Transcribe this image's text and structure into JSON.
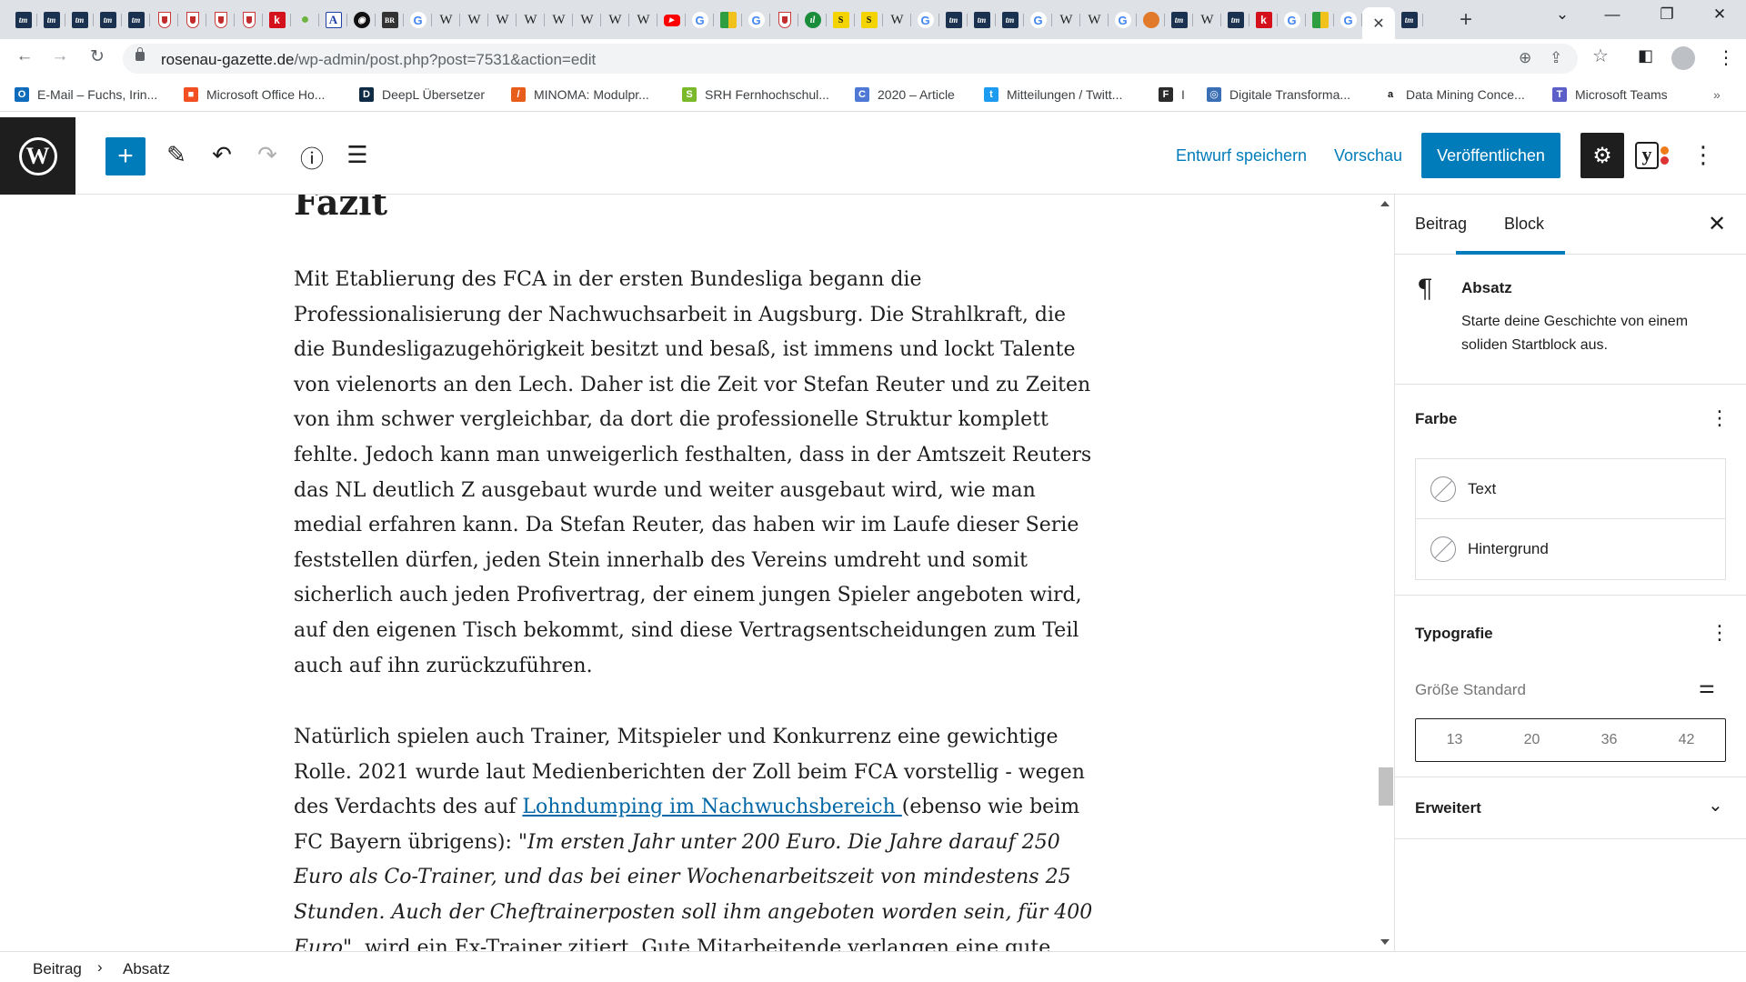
{
  "browser": {
    "tabs": [
      {
        "icon": "transfermarkt-icon",
        "glyph": "tm",
        "kind": "tm"
      },
      {
        "icon": "transfermarkt-icon",
        "glyph": "tm",
        "kind": "tm"
      },
      {
        "icon": "transfermarkt-icon",
        "glyph": "tm",
        "kind": "tm"
      },
      {
        "icon": "transfermarkt-icon",
        "glyph": "tm",
        "kind": "tm"
      },
      {
        "icon": "transfermarkt-icon",
        "glyph": "tm",
        "kind": "tm"
      },
      {
        "icon": "fc-augsburg-icon",
        "glyph": "",
        "kind": "fca"
      },
      {
        "icon": "fc-augsburg-icon",
        "glyph": "",
        "kind": "fca"
      },
      {
        "icon": "fc-augsburg-icon",
        "glyph": "",
        "kind": "fca"
      },
      {
        "icon": "fc-augsburg-icon",
        "glyph": "",
        "kind": "fca"
      },
      {
        "icon": "kicker-icon",
        "glyph": "k",
        "kind": "k"
      },
      {
        "icon": "maps-pin-icon",
        "glyph": "●",
        "kind": "pin"
      },
      {
        "icon": "a-icon",
        "glyph": "A",
        "kind": "a"
      },
      {
        "icon": "black-circle-icon",
        "glyph": "◉",
        "kind": "blk"
      },
      {
        "icon": "dark-icon",
        "glyph": "BR",
        "kind": "dark"
      },
      {
        "icon": "google-icon",
        "glyph": "G",
        "kind": "g"
      },
      {
        "icon": "wikipedia-icon",
        "glyph": "W",
        "kind": "w"
      },
      {
        "icon": "wikipedia-icon",
        "glyph": "W",
        "kind": "w"
      },
      {
        "icon": "wikipedia-icon",
        "glyph": "W",
        "kind": "w"
      },
      {
        "icon": "wikipedia-icon",
        "glyph": "W",
        "kind": "w"
      },
      {
        "icon": "wikipedia-icon",
        "glyph": "W",
        "kind": "w"
      },
      {
        "icon": "wikipedia-icon",
        "glyph": "W",
        "kind": "w"
      },
      {
        "icon": "wikipedia-icon",
        "glyph": "W",
        "kind": "w"
      },
      {
        "icon": "wikipedia-icon",
        "glyph": "W",
        "kind": "w"
      },
      {
        "icon": "youtube-icon",
        "glyph": "▶",
        "kind": "yt"
      },
      {
        "icon": "google-icon",
        "glyph": "G",
        "kind": "g"
      },
      {
        "icon": "grid-icon",
        "glyph": "",
        "kind": "grid"
      },
      {
        "icon": "google-icon",
        "glyph": "G",
        "kind": "g"
      },
      {
        "icon": "fc-augsburg-icon",
        "glyph": "",
        "kind": "fca"
      },
      {
        "icon": "green-circle-icon",
        "glyph": "ıl",
        "kind": "grn"
      },
      {
        "icon": "s-icon",
        "glyph": "S",
        "kind": "ys"
      },
      {
        "icon": "s-icon",
        "glyph": "S",
        "kind": "ys"
      },
      {
        "icon": "wikipedia-icon",
        "glyph": "W",
        "kind": "w"
      },
      {
        "icon": "google-icon",
        "glyph": "G",
        "kind": "g"
      },
      {
        "icon": "transfermarkt-icon",
        "glyph": "tm",
        "kind": "tm"
      },
      {
        "icon": "transfermarkt-icon",
        "glyph": "tm",
        "kind": "tm"
      },
      {
        "icon": "transfermarkt-icon",
        "glyph": "tm",
        "kind": "tm"
      },
      {
        "icon": "google-icon",
        "glyph": "G",
        "kind": "g"
      },
      {
        "icon": "wikipedia-icon",
        "glyph": "W",
        "kind": "w"
      },
      {
        "icon": "wikipedia-icon",
        "glyph": "W",
        "kind": "w"
      },
      {
        "icon": "google-icon",
        "glyph": "G",
        "kind": "g"
      },
      {
        "icon": "orange-circle-icon",
        "glyph": "",
        "kind": "orn"
      },
      {
        "icon": "transfermarkt-icon",
        "glyph": "tm",
        "kind": "tm"
      },
      {
        "icon": "wikipedia-icon",
        "glyph": "W",
        "kind": "w"
      },
      {
        "icon": "transfermarkt-icon",
        "glyph": "tm",
        "kind": "tm"
      },
      {
        "icon": "kicker-icon",
        "glyph": "k",
        "kind": "k"
      },
      {
        "icon": "google-icon",
        "glyph": "G",
        "kind": "g"
      },
      {
        "icon": "grid-icon",
        "glyph": "",
        "kind": "grid"
      },
      {
        "icon": "google-icon",
        "glyph": "G",
        "kind": "g"
      }
    ],
    "active_tab_close": "✕",
    "after_active_tab": {
      "icon": "transfermarkt-icon",
      "glyph": "tm",
      "kind": "tm"
    },
    "new_tab": "+",
    "window_controls": {
      "dropdown": "⌄",
      "minimize": "—",
      "restore": "❐",
      "close": "✕"
    },
    "nav": {
      "back": "←",
      "forward": "→",
      "reload": "↻"
    },
    "url_host": "rosenau-gazette.de",
    "url_path": "/wp-admin/post.php?post=7531&action=edit",
    "omni_icons": {
      "zoom": "⊕",
      "share": "⇪",
      "star": "☆"
    },
    "toolbar_icons": {
      "sidepanel": "◧",
      "menu": "⋮"
    },
    "bookmarks": [
      {
        "label": "E-Mail – Fuchs, Irin...",
        "icon": "outlook-icon",
        "color": "#0f6cbd",
        "glyph": "O"
      },
      {
        "label": "Microsoft Office Ho...",
        "icon": "microsoft-icon",
        "color": "#f25022",
        "glyph": "■"
      },
      {
        "label": "DeepL Übersetzer",
        "icon": "deepl-icon",
        "color": "#0f2b46",
        "glyph": "D"
      },
      {
        "label": "MINOMA: Modulpr...",
        "icon": "minoma-icon",
        "color": "#e85d1a",
        "glyph": "/"
      },
      {
        "label": "SRH Fernhochschul...",
        "icon": "srh-icon",
        "color": "#7ab929",
        "glyph": "S"
      },
      {
        "label": "2020 – Article",
        "icon": "article-icon",
        "color": "#4f78d6",
        "glyph": "C"
      },
      {
        "label": "Mitteilungen / Twitt...",
        "icon": "twitter-icon",
        "color": "#1d9bf0",
        "glyph": "t"
      },
      {
        "label": "I",
        "icon": "fca-bookmark-icon",
        "color": "#2b2b2b",
        "glyph": "F"
      },
      {
        "label": "Digitale Transforma...",
        "icon": "globe-icon",
        "color": "#3a6fb5",
        "glyph": "◎"
      },
      {
        "label": "Data Mining Conce...",
        "icon": "amazon-icon",
        "color": "#ffffff",
        "glyph": "a"
      },
      {
        "label": "Microsoft Teams",
        "icon": "teams-icon",
        "color": "#5b5fc7",
        "glyph": "T"
      }
    ],
    "bookmarks_more": "»"
  },
  "wp_header": {
    "logo": "W",
    "add_icon": "+",
    "tools": {
      "pen": "✎",
      "undo": "↶",
      "redo": "↷",
      "info": "ⓘ",
      "list": "☰"
    },
    "save_draft": "Entwurf speichern",
    "preview": "Vorschau",
    "publish": "Veröffentlichen",
    "settings_icon": "⚙",
    "yoast": "y",
    "more": "⋮"
  },
  "colors": {
    "accent": "#007cba",
    "dark": "#1e1e1e",
    "yoast_red": "#dc3232",
    "yoast_orange": "#ee7c1b"
  },
  "post": {
    "heading": "Fazit",
    "para1": "Mit Etablierung des FCA in der ersten Bundesliga begann die Professionalisierung der Nachwuchsarbeit in Augsburg. Die Strahlkraft, die die Bundesligazugehörigkeit besitzt und besaß, ist immens und lockt Talente von vielenorts an den Lech. Daher ist die Zeit vor Stefan Reuter und zu Zeiten von ihm schwer vergleichbar, da dort die professionelle Struktur komplett fehlte. Jedoch kann man unweigerlich festhalten, dass in der Amtszeit Reuters das NL deutlich Z ausgebaut wurde und weiter ausgebaut wird, wie man medial erfahren kann. Da Stefan Reuter, das haben wir im Laufe dieser Serie feststellen dürfen, jeden Stein innerhalb des Vereins umdreht und somit sicherlich auch jeden Profivertrag, der einem jungen Spieler angeboten wird, auf den eigenen Tisch bekommt, sind diese Vertragsentscheidungen zum Teil auch auf ihn zurückzuführen.",
    "para2_a": "Natürlich spielen auch Trainer, Mitspieler und Konkurrenz eine gewichtige Rolle. 2021 wurde laut Medienberichten der Zoll beim FCA vorstellig - wegen des Verdachts des auf ",
    "para2_link": "Lohndumping im Nachwuchsbereich ",
    "para2_b": "(ebenso wie beim FC Bayern übrigens): ",
    "para2_quote": "\"Im ersten Jahr unter 200 Euro. Die Jahre darauf 250 Euro als Co-Trainer, und das bei einer Wochenarbeitszeit von mindestens 25 Stunden. Auch der Cheftrainerposten soll ihm angeboten worden sein, für 400 Euro\"",
    "para2_c": ", wird ein Ex-Trainer zitiert. Gute Mitarbeitende verlangen eine gute Bezahlung - so ist das in"
  },
  "sidebar": {
    "tab_post": "Beitrag",
    "tab_block": "Block",
    "close": "✕",
    "block_icon": "¶",
    "block_title": "Absatz",
    "block_desc": "Starte deine Geschichte von einem soliden Startblock aus.",
    "color_title": "Farbe",
    "color_text": "Text",
    "color_bg": "Hintergrund",
    "typo_title": "Typografie",
    "size_label": "Größe",
    "size_value": "Standard",
    "sizes": [
      "13",
      "20",
      "36",
      "42"
    ],
    "advanced": "Erweitert",
    "dots": "⋮",
    "sliders": "⚌",
    "chevron": "⌄"
  },
  "footer": {
    "crumb1": "Beitrag",
    "sep": "›",
    "crumb2": "Absatz"
  }
}
